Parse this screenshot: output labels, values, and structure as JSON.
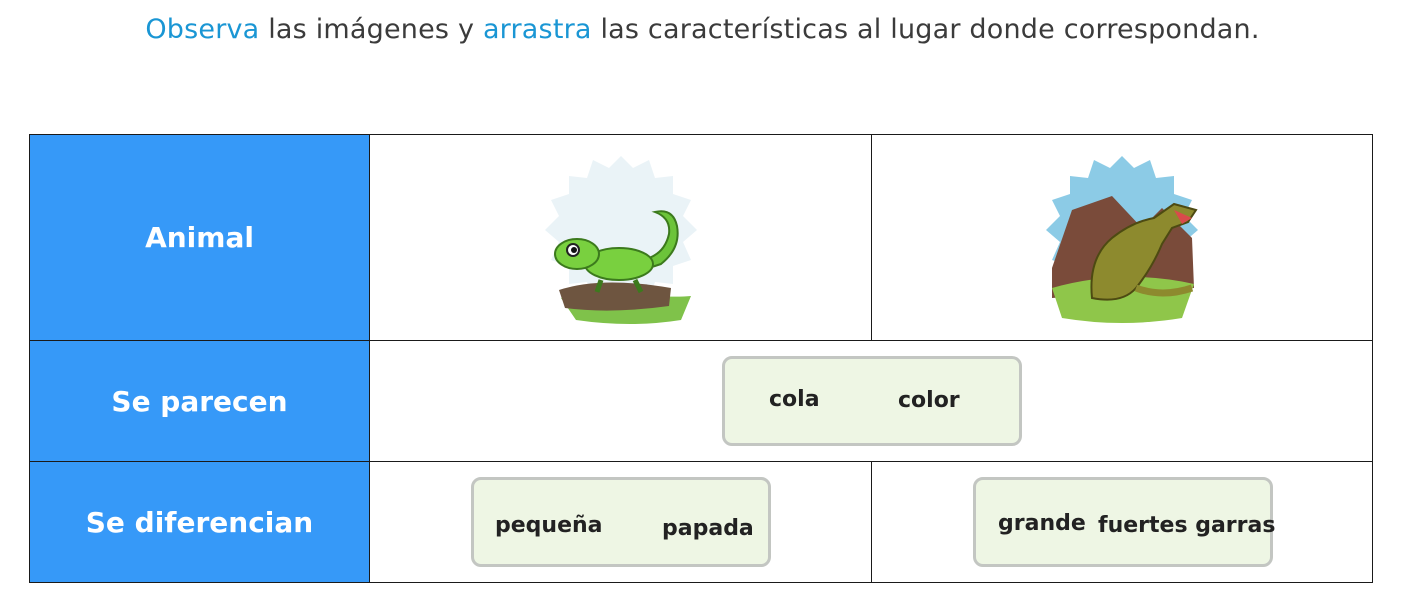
{
  "instruction": {
    "w1": "Observa",
    "w2": " las imágenes y ",
    "w3": "arrastra",
    "w4": " las características al lugar donde correspondan."
  },
  "rows": {
    "animal": "Animal",
    "similar": "Se parecen",
    "different": "Se diferencian"
  },
  "similar_zone": {
    "items": [
      "cola",
      "color"
    ]
  },
  "iguana_zone": {
    "items": [
      "pequeña",
      "papada"
    ]
  },
  "dino_zone": {
    "items": [
      "grande",
      "fuertes garras"
    ]
  },
  "colors": {
    "header_bg": "#3699f8",
    "accent_text": "#1a96d4",
    "zone_bg": "#eef6e4"
  }
}
